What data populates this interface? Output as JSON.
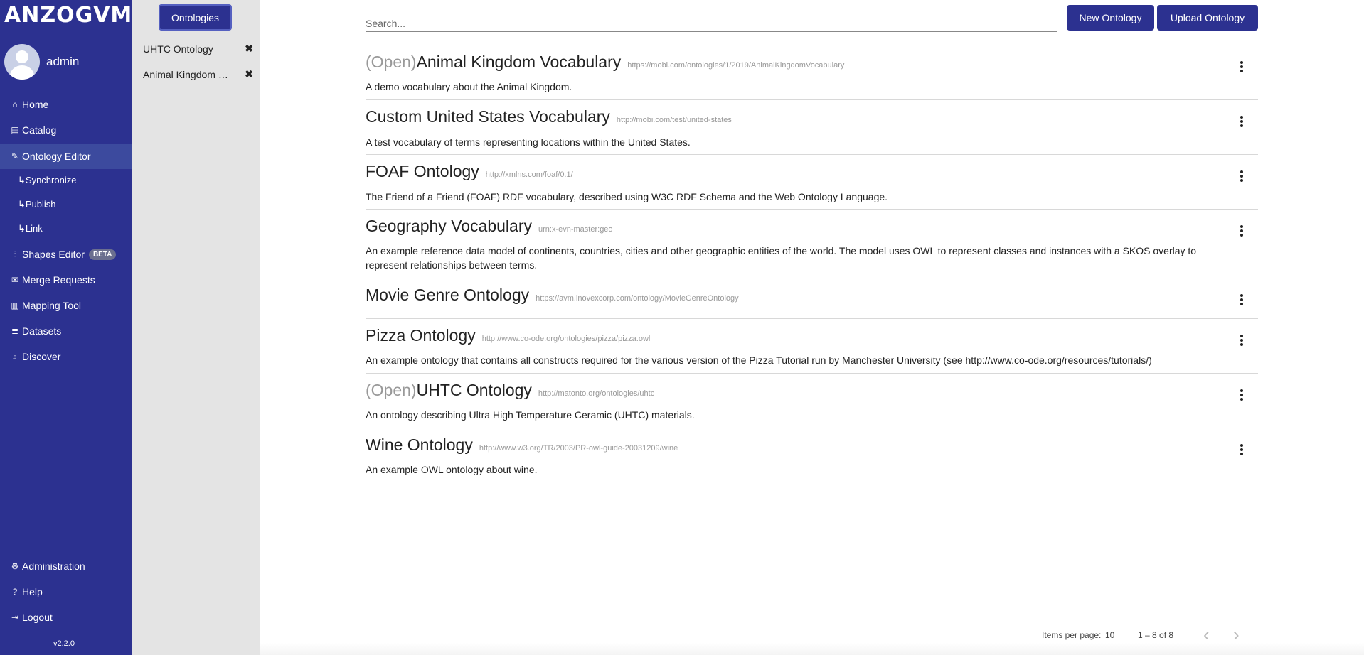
{
  "nav": {
    "logo": "ANZOGVM",
    "user": "admin",
    "items": [
      {
        "label": "Home",
        "icon": "home-icon"
      },
      {
        "label": "Catalog",
        "icon": "book-icon"
      },
      {
        "label": "Ontology Editor",
        "icon": "edit-icon"
      },
      {
        "label": "Shapes Editor",
        "icon": "shapes-icon",
        "badge": "BETA"
      },
      {
        "label": "Merge Requests",
        "icon": "envelope-icon"
      },
      {
        "label": "Mapping Tool",
        "icon": "map-icon"
      },
      {
        "label": "Datasets",
        "icon": "database-icon"
      },
      {
        "label": "Discover",
        "icon": "search-icon"
      }
    ],
    "subitems": [
      "↳Synchronize",
      "↳Publish",
      "↳Link"
    ],
    "bottom": [
      {
        "label": "Administration",
        "icon": "gear-icon"
      },
      {
        "label": "Help",
        "icon": "question-icon"
      },
      {
        "label": "Logout",
        "icon": "logout-icon"
      }
    ],
    "version": "v2.2.0",
    "accent": "#2c3190"
  },
  "tabs": {
    "ontologies_button": "Ontologies",
    "open": [
      "UHTC Ontology",
      "Animal Kingdom Vocabulary"
    ]
  },
  "main": {
    "search_placeholder": "Search...",
    "new_button": "New Ontology",
    "upload_button": "Upload Ontology",
    "rows": [
      {
        "open": "(Open)",
        "title": "Animal Kingdom Vocabulary",
        "iri": "https://mobi.com/ontologies/1/2019/AnimalKingdomVocabulary",
        "desc": "A demo vocabulary about the Animal Kingdom."
      },
      {
        "open": "",
        "title": "Custom United States Vocabulary",
        "iri": "http://mobi.com/test/united-states",
        "desc": "A test vocabulary of terms representing locations within the United States."
      },
      {
        "open": "",
        "title": "FOAF Ontology",
        "iri": "http://xmlns.com/foaf/0.1/",
        "desc": "The Friend of a Friend (FOAF) RDF vocabulary, described using W3C RDF Schema and the Web Ontology Language."
      },
      {
        "open": "",
        "title": "Geography Vocabulary",
        "iri": "urn:x-evn-master:geo",
        "desc": "An example reference data model of continents, countries, cities and other geographic entities of the world. The model uses OWL to represent classes and instances with a SKOS overlay to represent relationships between terms."
      },
      {
        "open": "",
        "title": "Movie Genre Ontology",
        "iri": "https://avm.inovexcorp.com/ontology/MovieGenreOntology",
        "desc": ""
      },
      {
        "open": "",
        "title": "Pizza Ontology",
        "iri": "http://www.co-ode.org/ontologies/pizza/pizza.owl",
        "desc": "An example ontology that contains all constructs required for the various version of the Pizza Tutorial run by Manchester University (see http://www.co-ode.org/resources/tutorials/)"
      },
      {
        "open": "(Open)",
        "title": "UHTC Ontology",
        "iri": "http://matonto.org/ontologies/uhtc",
        "desc": "An ontology describing Ultra High Temperature Ceramic (UHTC) materials."
      },
      {
        "open": "",
        "title": "Wine Ontology",
        "iri": "http://www.w3.org/TR/2003/PR-owl-guide-20031209/wine",
        "desc": "An example OWL ontology about wine."
      }
    ]
  },
  "pagination": {
    "items_per_page_label": "Items per page:",
    "items_per_page": "10",
    "range": "1 – 8 of 8"
  }
}
